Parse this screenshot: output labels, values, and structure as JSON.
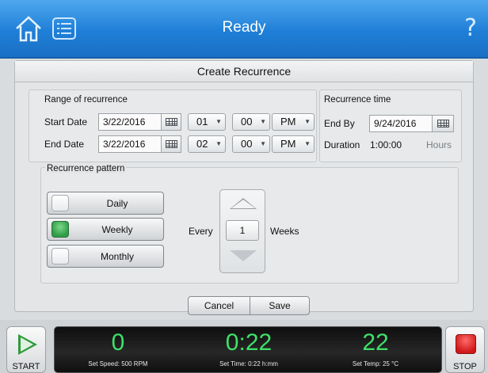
{
  "header": {
    "title": "Ready",
    "home_icon": "home-icon",
    "list_icon": "list-icon",
    "help_icon": "question-mark-icon",
    "help_glyph": "?"
  },
  "dialog": {
    "title": "Create Recurrence",
    "range": {
      "label": "Range of recurrence",
      "start": {
        "label": "Start Date",
        "date": "3/22/2016",
        "hour": "01",
        "minute": "00",
        "ampm": "PM"
      },
      "end": {
        "label": "End Date",
        "date": "3/22/2016",
        "hour": "02",
        "minute": "00",
        "ampm": "PM"
      }
    },
    "recurrence_time": {
      "label": "Recurrence time",
      "end_by_label": "End By",
      "end_by_date": "9/24/2016",
      "duration_label": "Duration",
      "duration_value": "1:00:00",
      "duration_unit": "Hours"
    },
    "pattern": {
      "label": "Recurrence pattern",
      "options": [
        {
          "label": "Daily",
          "selected": false
        },
        {
          "label": "Weekly",
          "selected": true
        },
        {
          "label": "Monthly",
          "selected": false
        }
      ],
      "every_label": "Every",
      "every_value": "1",
      "unit_label": "Weeks"
    },
    "buttons": {
      "cancel": "Cancel",
      "save": "Save"
    }
  },
  "status": {
    "start_label": "START",
    "stop_label": "STOP",
    "speed": {
      "value": "0",
      "caption": "Set Speed: 500 RPM"
    },
    "time": {
      "value": "0:22",
      "caption": "Set Time: 0:22 h:mm"
    },
    "temp": {
      "value": "22",
      "caption": "Set Temp: 25 °C"
    }
  },
  "colors": {
    "header_blue": "#1f7fd7",
    "readout_green": "#3fe06a",
    "selected_green": "#2f9e46",
    "stop_red": "#d01818"
  }
}
